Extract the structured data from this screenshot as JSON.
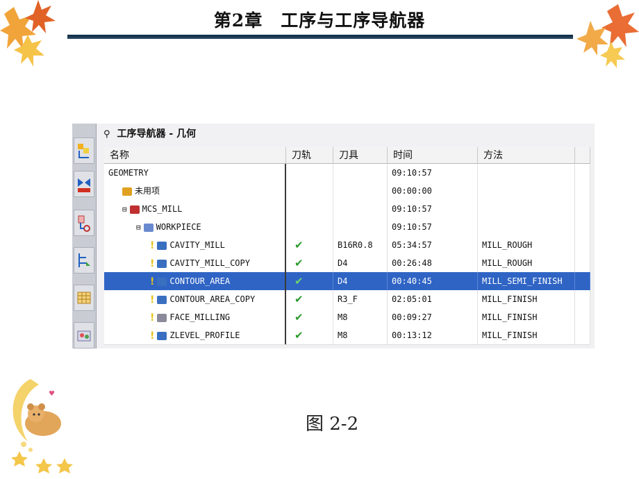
{
  "slide": {
    "title": "第2章　工序与工序导航器",
    "caption": "图 2-2"
  },
  "navigator": {
    "title": "工序导航器 - 几何",
    "columns": [
      "名称",
      "刀轨",
      "刀具",
      "时间",
      "方法"
    ],
    "rows": [
      {
        "name": "GEOMETRY",
        "path": "",
        "tool": "",
        "time": "09:10:57",
        "method": ""
      },
      {
        "name": "未用项",
        "path": "",
        "tool": "",
        "time": "00:00:00",
        "method": ""
      },
      {
        "name": "MCS_MILL",
        "path": "",
        "tool": "",
        "time": "09:10:57",
        "method": ""
      },
      {
        "name": "WORKPIECE",
        "path": "",
        "tool": "",
        "time": "09:10:57",
        "method": ""
      },
      {
        "name": "CAVITY_MILL",
        "path": "✔",
        "tool": "B16R0.8",
        "time": "05:34:57",
        "method": "MILL_ROUGH"
      },
      {
        "name": "CAVITY_MILL_COPY",
        "path": "✔",
        "tool": "D4",
        "time": "00:26:48",
        "method": "MILL_ROUGH"
      },
      {
        "name": "CONTOUR_AREA",
        "path": "✔",
        "tool": "D4",
        "time": "00:40:45",
        "method": "MILL_SEMI_FINISH"
      },
      {
        "name": "CONTOUR_AREA_COPY",
        "path": "✔",
        "tool": "R3_F",
        "time": "02:05:01",
        "method": "MILL_FINISH"
      },
      {
        "name": "FACE_MILLING",
        "path": "✔",
        "tool": "M8",
        "time": "00:09:27",
        "method": "MILL_FINISH"
      },
      {
        "name": "ZLEVEL_PROFILE",
        "path": "✔",
        "tool": "M8",
        "time": "00:13:12",
        "method": "MILL_FINISH"
      }
    ],
    "selected_row": "CONTOUR_AREA"
  },
  "colors": {
    "selection": "#2f64c4",
    "check": "#2a9a2a",
    "title_rule": "#0d2a44"
  },
  "icons": {
    "tree_toggle": "minus-box-icon",
    "operation_status": "warning-bulb-icon",
    "toolbar": [
      "operation-nav-icon",
      "machine-tool-icon",
      "geometry-icon",
      "method-icon",
      "table-icon",
      "palette-icon"
    ]
  }
}
